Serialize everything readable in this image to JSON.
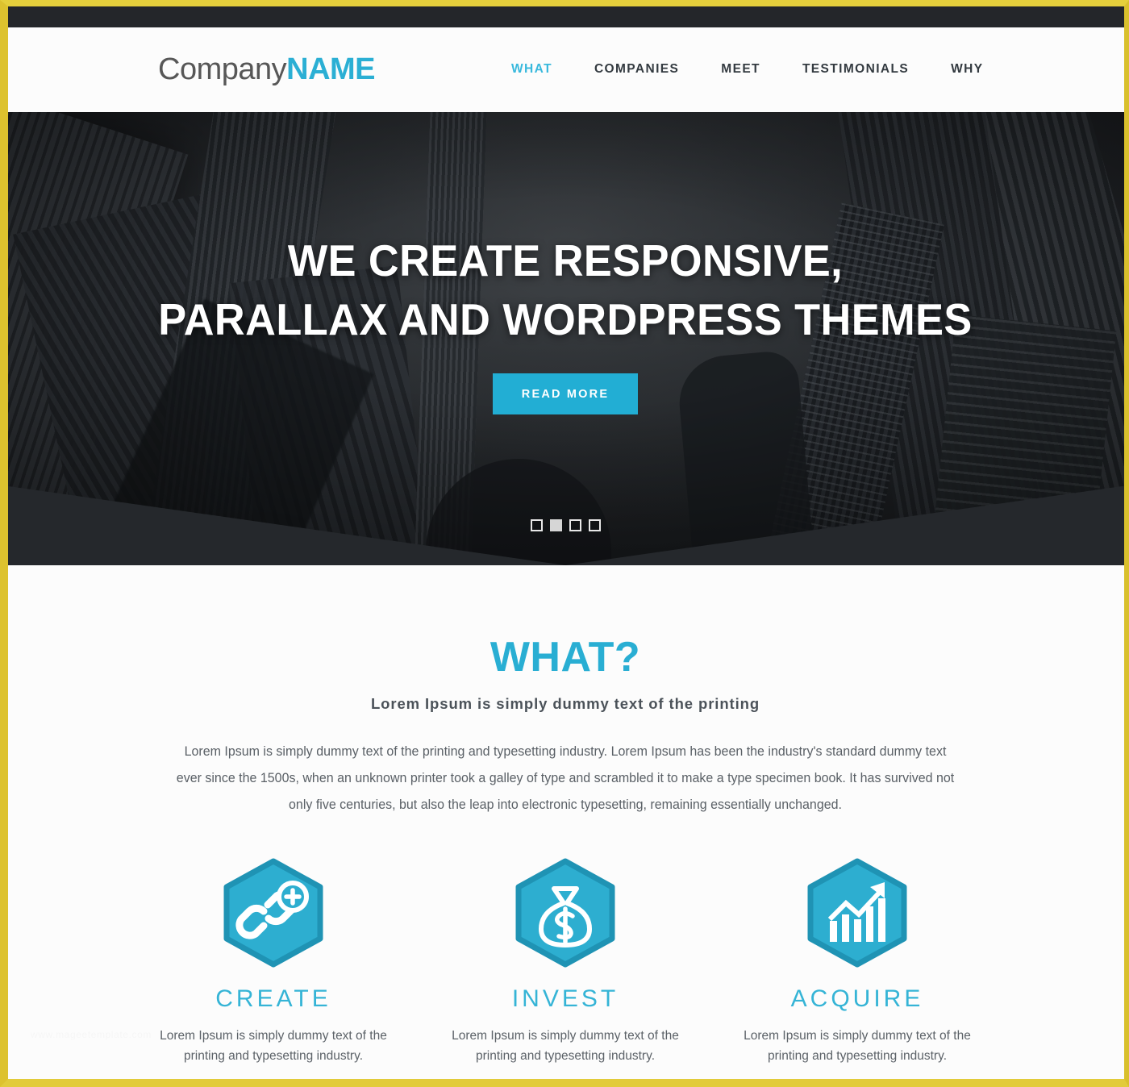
{
  "brand": {
    "logo_light": "Company",
    "logo_bold": "NAME",
    "accent_color": "#29aed3",
    "logo_text_color": "#575757",
    "frame_color": "#ddc22e"
  },
  "nav": {
    "items": [
      {
        "label": "WHAT",
        "active": true
      },
      {
        "label": "COMPANIES",
        "active": false
      },
      {
        "label": "MEET",
        "active": false
      },
      {
        "label": "TESTIMONIALS",
        "active": false
      },
      {
        "label": "WHY",
        "active": false
      }
    ]
  },
  "hero": {
    "title_line1": "WE CREATE RESPONSIVE,",
    "title_line2": "PARALLAX AND WORDPRESS THEMES",
    "cta_label": "READ MORE",
    "cta_color": "#22aed4",
    "slider": {
      "count": 4,
      "active_index": 1
    }
  },
  "what": {
    "heading": "WHAT?",
    "subheading": "Lorem Ipsum is simply dummy text of the printing",
    "body": "Lorem Ipsum is simply dummy text of the printing and typesetting industry. Lorem Ipsum has been the industry's standard dummy text ever since the 1500s, when an unknown printer took a galley of type and scrambled it to make a type specimen book. It has survived not only five centuries, but also the leap into electronic typesetting, remaining essentially unchanged."
  },
  "features": [
    {
      "icon": "link-plus-icon",
      "title": "CREATE",
      "desc": "Lorem Ipsum is simply dummy text of the printing and typesetting industry."
    },
    {
      "icon": "money-bag-icon",
      "title": "INVEST",
      "desc": "Lorem Ipsum is simply dummy text of the printing and typesetting industry."
    },
    {
      "icon": "growth-chart-icon",
      "title": "ACQUIRE",
      "desc": "Lorem Ipsum is simply dummy text of the printing and typesetting industry."
    }
  ],
  "watermark": {
    "text": "www.mageetemplate.com"
  }
}
